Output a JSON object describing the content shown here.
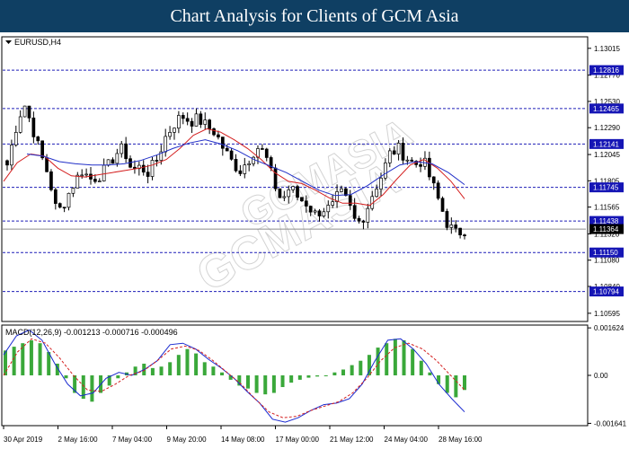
{
  "banner": {
    "title": "Chart Analysis for Clients of GCM Asia"
  },
  "chart_data": [
    {
      "type": "candlestick",
      "title": "EURUSD,H4",
      "ylim": [
        1.1052,
        1.1312
      ],
      "y_ticks": [
        "1.13015",
        "1.12770",
        "1.12530",
        "1.12290",
        "1.12045",
        "1.11805",
        "1.11565",
        "1.11320",
        "1.11080",
        "1.10840",
        "1.10595"
      ],
      "current_price": "1.11364",
      "levels": [
        {
          "label": "1.12816",
          "value": 1.12816
        },
        {
          "label": "1.12465",
          "value": 1.12465
        },
        {
          "label": "1.12141",
          "value": 1.12141
        },
        {
          "label": "1.11745",
          "value": 1.11745
        },
        {
          "label": "1.11438",
          "value": 1.11438
        },
        {
          "label": "1.11150",
          "value": 1.1115
        },
        {
          "label": "1.10794",
          "value": 1.10794
        }
      ],
      "x_labels": [
        "30 Apr 2019",
        "2 May 16:00",
        "7 May 04:00",
        "9 May 20:00",
        "14 May 08:00",
        "17 May 00:00",
        "21 May 12:00",
        "24 May 04:00",
        "28 May 16:00"
      ],
      "close_path": [
        1.1195,
        1.1228,
        1.1252,
        1.123,
        1.1205,
        1.1185,
        1.115,
        1.1163,
        1.1178,
        1.119,
        1.1182,
        1.1185,
        1.1192,
        1.1205,
        1.121,
        1.119,
        1.1193,
        1.1188,
        1.12,
        1.122,
        1.1232,
        1.124,
        1.1235,
        1.1237,
        1.123,
        1.1225,
        1.121,
        1.1198,
        1.119,
        1.12,
        1.1212,
        1.1205,
        1.118,
        1.1162,
        1.1175,
        1.1165,
        1.116,
        1.115,
        1.1155,
        1.1155,
        1.117,
        1.116,
        1.114,
        1.115,
        1.117,
        1.1185,
        1.1205,
        1.121,
        1.1202,
        1.1195,
        1.12,
        1.118,
        1.116,
        1.114,
        1.1132,
        1.1136
      ],
      "ma_red": [
        1.118,
        1.1197,
        1.1205,
        1.1203,
        1.1192,
        1.1185,
        1.1184,
        1.1186,
        1.1188,
        1.119,
        1.1192,
        1.1195,
        1.12,
        1.121,
        1.1222,
        1.1228,
        1.1225,
        1.1218,
        1.121,
        1.12,
        1.1188,
        1.118,
        1.1178,
        1.1172,
        1.1165,
        1.116,
        1.116,
        1.1158,
        1.1168,
        1.1182,
        1.1195,
        1.12,
        1.1192,
        1.118,
        1.1164
      ],
      "ma_blue": [
        1.1205,
        1.1203,
        1.1198,
        1.1196,
        1.1195,
        1.1195,
        1.1196,
        1.1199,
        1.1204,
        1.121,
        1.1215,
        1.1218,
        1.1214,
        1.1208,
        1.12,
        1.1194,
        1.1188,
        1.118,
        1.1172,
        1.1167,
        1.1168,
        1.1176,
        1.1186,
        1.1195,
        1.1198,
        1.1196,
        1.1188,
        1.1177
      ],
      "watermark": [
        "GCMASIA",
        "GCMASIA"
      ]
    },
    {
      "type": "bar+line",
      "title": "MACD(12,26,9) -0.001213 -0.000716 -0.000496",
      "ylim": [
        -0.00172,
        0.00172
      ],
      "y_ticks": [
        "0.001624",
        "0.00",
        "-0.001641"
      ],
      "histogram": [
        0.00085,
        0.00098,
        0.0011,
        0.0012,
        0.0011,
        0.0008,
        0.0004,
        -0.0001,
        -0.0006,
        -0.0008,
        -0.0009,
        -0.0006,
        -0.00035,
        -0.0001,
        0.0001,
        0.0003,
        0.0004,
        0.00025,
        0.0003,
        0.00045,
        0.0007,
        0.0009,
        0.00075,
        0.00045,
        0.0003,
        0.0001,
        -0.00015,
        -0.00035,
        -0.00045,
        -0.0006,
        -0.00065,
        -0.0006,
        -0.0004,
        -0.00025,
        -0.00015,
        -8e-05,
        -4e-05,
        0.0,
        0.0001,
        0.0002,
        0.00035,
        0.0005,
        0.0007,
        0.00095,
        0.0011,
        0.00125,
        0.0012,
        0.0009,
        0.0005,
        0.0001,
        -0.0003,
        -0.0006,
        -0.00075,
        -0.0005
      ],
      "macd_blue": [
        0.0007,
        0.00135,
        0.00155,
        0.0012,
        0.0004,
        -0.0003,
        -0.0007,
        -0.0006,
        -0.0001,
        0.0001,
        0.0,
        0.0002,
        0.0005,
        0.00105,
        0.0011,
        0.0009,
        0.00055,
        0.00025,
        -0.0001,
        -0.00055,
        -0.00095,
        -0.0015,
        -0.0016,
        -0.00145,
        -0.0012,
        -0.001,
        -0.00095,
        -0.0008,
        -0.0003,
        0.0005,
        0.0012,
        0.00125,
        0.0009,
        0.0004,
        -0.0003,
        -0.0008,
        -0.00125
      ],
      "signal_red": [
        0.0,
        0.0008,
        0.00125,
        0.0011,
        0.0006,
        0.0,
        -0.0005,
        -0.00055,
        -0.0003,
        0.0,
        0.00015,
        0.0005,
        0.0009,
        0.001,
        0.00085,
        0.0005,
        0.0001,
        -0.0003,
        -0.0008,
        -0.00125,
        -0.00145,
        -0.0014,
        -0.0012,
        -0.00105,
        -0.0009,
        -0.0006,
        -0.0001,
        0.0005,
        0.00095,
        0.0011,
        0.0009,
        0.0005,
        0.0,
        -0.0005
      ]
    }
  ]
}
